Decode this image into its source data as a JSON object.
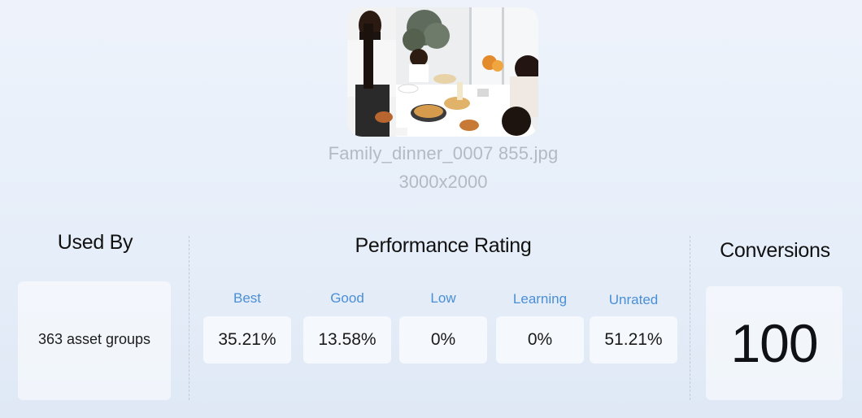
{
  "asset": {
    "file_name": "Family_dinner_0007 855.jpg",
    "dimensions": "3000x2000"
  },
  "used_by": {
    "title": "Used By",
    "value": "363 asset groups"
  },
  "performance": {
    "title": "Performance Rating",
    "ratings": [
      {
        "label": "Best",
        "value": "35.21%"
      },
      {
        "label": "Good",
        "value": "13.58%"
      },
      {
        "label": "Low",
        "value": "0%"
      },
      {
        "label": "Learning",
        "value": "0%"
      },
      {
        "label": "Unrated",
        "value": "51.21%"
      }
    ]
  },
  "conversions": {
    "title": "Conversions",
    "value": "100"
  },
  "colors": {
    "label_blue": "#4a8fd6",
    "meta_gray": "#b4bac2"
  }
}
